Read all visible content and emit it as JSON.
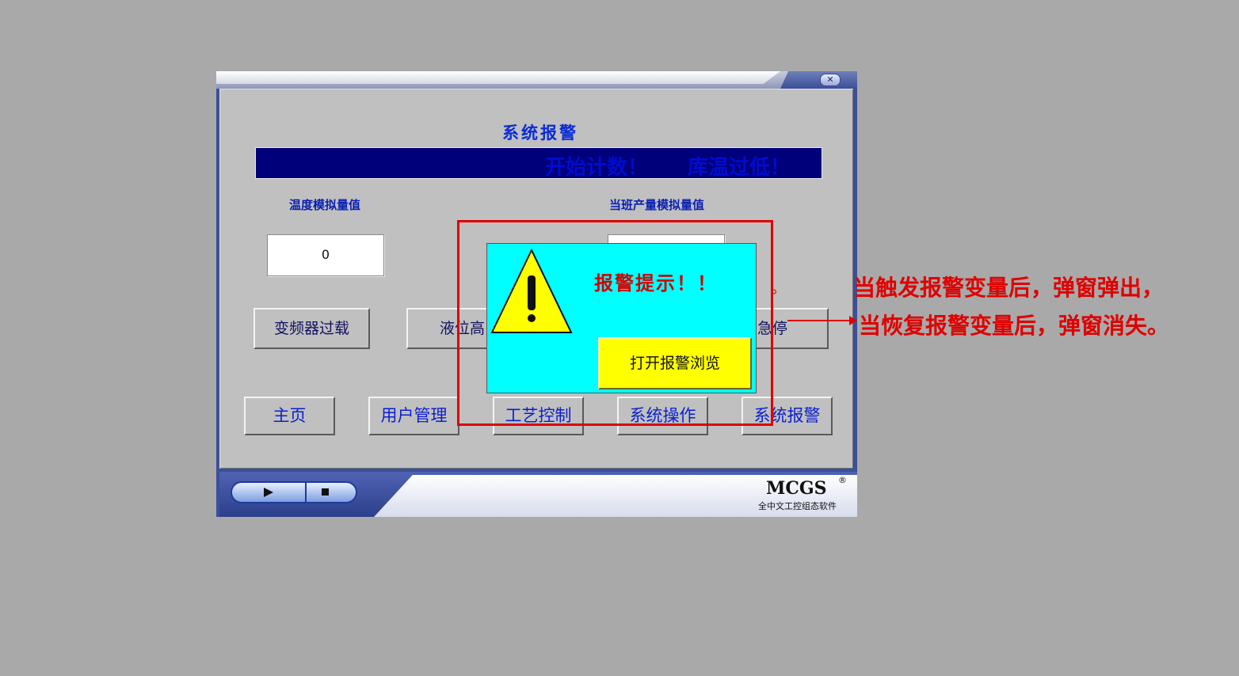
{
  "window": {
    "close_symbol": "✕"
  },
  "screen": {
    "title": "系统报警",
    "marquee_text_1": "开始计数！",
    "marquee_text_2": "库温过低！",
    "temperature_label": "温度模拟量值",
    "temperature_value": "0",
    "production_label": "当班产量模拟量值",
    "production_value": ""
  },
  "alarm_buttons": [
    {
      "label": "变频器过载"
    },
    {
      "label": "液位高"
    },
    {
      "label": "急停"
    }
  ],
  "nav_buttons": [
    {
      "label": "主页"
    },
    {
      "label": "用户管理"
    },
    {
      "label": "工艺控制"
    },
    {
      "label": "系统操作"
    },
    {
      "label": "系统报警"
    }
  ],
  "popup": {
    "title": "报警提示！！",
    "button_label": "打开报警浏览",
    "icon": "warning-triangle-icon"
  },
  "bottom_bar": {
    "brand": "MCGS",
    "registered": "®",
    "subtitle": "全中文工控组态软件",
    "play_icon": "play-icon",
    "stop_icon": "stop-icon"
  },
  "annotation": {
    "line_1": "当触发报警变量后，弹窗弹出，",
    "line_2": "当恢复报警变量后，弹窗消失。",
    "dot": "。"
  },
  "colors": {
    "background": "#a9a9a9",
    "screen_bg": "#c0c0c0",
    "alarm_bar": "#00007a",
    "popup_bg": "#00ffff",
    "popup_button": "#ffff00",
    "annotation_red": "#e00000"
  }
}
